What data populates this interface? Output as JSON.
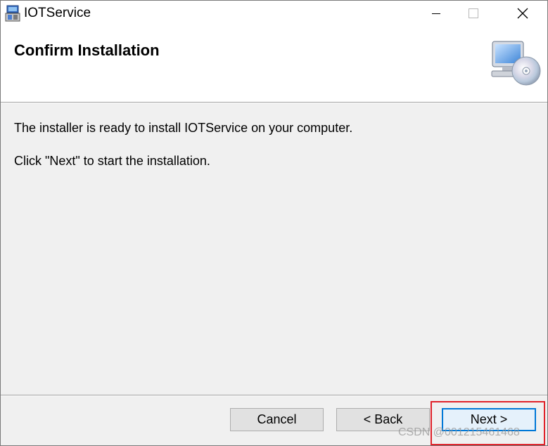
{
  "window": {
    "title": "IOTService",
    "controls": {
      "minimize": "minimize-icon",
      "maximize": "maximize-icon",
      "close": "close-icon"
    }
  },
  "header": {
    "title": "Confirm Installation",
    "icon": "computer-cd-icon"
  },
  "body": {
    "line1": "The installer is ready to install IOTService on your computer.",
    "line2": "Click \"Next\" to start the installation."
  },
  "buttons": {
    "cancel": "Cancel",
    "back": "< Back",
    "next": "Next >"
  },
  "annotation": {
    "highlight_color": "#e0222a"
  },
  "watermark": "CSDN @001215461468",
  "colors": {
    "accent": "#0078d7",
    "background": "#f0f0f0",
    "header_background": "#ffffff"
  }
}
